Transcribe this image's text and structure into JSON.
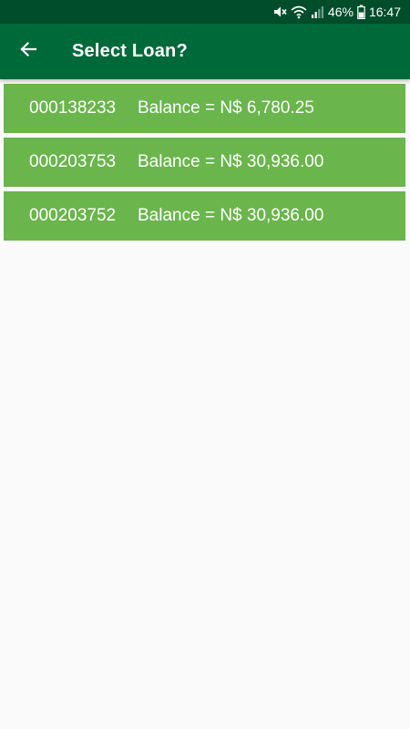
{
  "status_bar": {
    "icons": [
      "mute-icon",
      "wifi-icon",
      "signal-icon",
      "battery-icon"
    ],
    "battery": "46%",
    "time": "16:47"
  },
  "header": {
    "back_icon": "arrow-left-icon",
    "title": "Select Loan?"
  },
  "loans": [
    {
      "number": "000138233",
      "balance": "Balance = N$ 6,780.25"
    },
    {
      "number": "000203753",
      "balance": "Balance = N$ 30,936.00"
    },
    {
      "number": "000203752",
      "balance": "Balance = N$ 30,936.00"
    }
  ],
  "colors": {
    "status_bar": "#004d2b",
    "app_bar": "#00693a",
    "loan_item": "#6ab54c",
    "background": "#fafafa"
  }
}
